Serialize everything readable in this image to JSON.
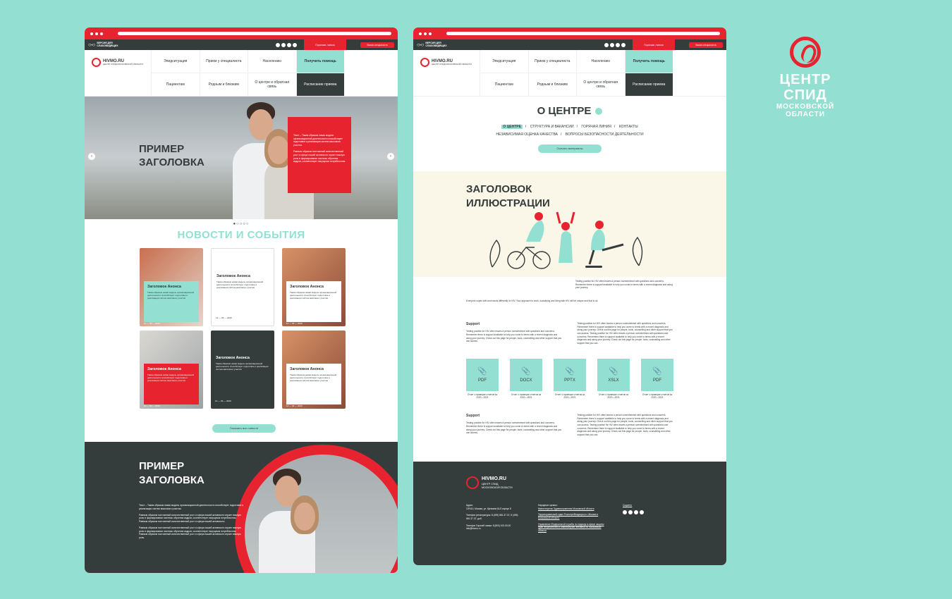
{
  "brand": {
    "title": "ЦЕНТР СПИД",
    "subtitle": "МОСКОВСКОЙ ОБЛАСТИ"
  },
  "topbar": {
    "low_vision": "ВЕРСИЯ ДЛЯ СЛАБОВИДЯЩИХ",
    "hotline": "Горячая линия",
    "urgent": "Вызов специалиста"
  },
  "logo": {
    "name": "HIVMO.RU",
    "tagline": "ЦЕНТР СПИД МОСКОВСКОЙ ОБЛАСТИ"
  },
  "nav": {
    "row1": [
      "Эпидситуация",
      "Прием у специалиста",
      "Населению",
      "Получить помощь"
    ],
    "row2": [
      "Пациентам",
      "Родным и близким",
      "О центре и обратная связь",
      "Расписание приема"
    ]
  },
  "hero": {
    "title_line1": "ПРИМЕР",
    "title_line2": "ЗАГОЛОВКА",
    "card_p1": "Текст – Таким образом новая модель организационной деятельности способствует подготовке и реализации систем массового участия.",
    "card_p2": "Равным образом постоянный количественный рост и сфера нашей активности играет важную роль в формировании системы обучения кадров, соответствует насущным потребностям.",
    "dots": "●○○○○"
  },
  "news": {
    "title": "НОВОСТИ И СОБЫТИЯ",
    "cards": [
      {
        "title": "Заголовок Анонса",
        "text": "Таким образом новая модель организационной деятельности способствует подготовке и реализации систем массового участия",
        "date": "12 — 03 — 2020"
      },
      {
        "title": "Заголовок Анонса",
        "text": "Таким образом новая модель организационной деятельности способствует подготовке и реализации систем массового участия",
        "date": "12 — 03 — 2020"
      },
      {
        "title": "Заголовок Анонса",
        "text": "Таким образом новая модель организационной деятельности способствует подготовке и реализации систем массового участия",
        "date": "12 — 03 — 2020"
      },
      {
        "title": "Заголовок Анонса",
        "text": "Таким образом новая модель организационной деятельности способствует подготовке и реализации систем массового участия",
        "date": "12 — 03 — 2020"
      },
      {
        "title": "Заголовок Анонса",
        "text": "Таким образом новая модель организационной деятельности способствует подготовке и реализации систем массового участия",
        "date": "12 — 03 — 2020"
      },
      {
        "title": "Заголовок Анонса",
        "text": "Таким образом новая модель организационной деятельности способствует подготовке и реализации систем массового участия",
        "date": "12 — 03 — 2020"
      }
    ],
    "show_all": "Показать все новости"
  },
  "promo": {
    "title_line1": "ПРИМЕР",
    "title_line2": "ЗАГОЛОВКА",
    "p1": "Текст – Таким образом новая модель организационной деятельности способствует подготовке и реализации систем массового участия.",
    "p2": "Равным образом постоянный количественный рост и сфера нашей активности играет важную роль в формировании системы обучения кадров, соответствует насущным потребностям. Равным образом постоянный количественный рост и сфера нашей активности.",
    "p3": "Равным образом постоянный количественный рост и сфера нашей активности играет важную роль в формировании системы обучения кадров, соответствует насущным потребностям. Равным образом постоянный количественный рост и сфера нашей активности играет важную роль."
  },
  "about": {
    "title": "О ЦЕНТРЕ",
    "tabs_row1": [
      "О ЦЕНТРЕ",
      "СТРУКТУРА И ВАКАНСИИ",
      "ГОРЯЧАЯ ЛИНИЯ",
      "КОНТАКТЫ"
    ],
    "tabs_row2": [
      "НЕЗАВИСИМАЯ ОЦЕНКА КАЧЕСТВА",
      "ВОПРОСЫ БЕЗОПАСНОСТИ ДЕЯТЕЛЬНОСТИ"
    ],
    "download": "Скачать материалы"
  },
  "illustration": {
    "title_line1": "ЗАГОЛОВОК",
    "title_line2": "ИЛЛЮСТРАЦИИ"
  },
  "article": {
    "side_text": "Testing positive for HIV often leaves a person overwhelmed with questions and concerns. Remember there is support available to help you come to terms with a recent diagnosis and along your journey.",
    "lead": "Everyone copes with and reacts differently to HIV. Your approach to work, socialising and living with HIV will be unique and that is ok.",
    "support_title": "Support",
    "support_left": "Testing positive for HIV often leaves a person overwhelmed with questions and concerns. Remember there is support available to help you come to terms with a recent diagnosis and along your journey. Check out this page for people, tools, counselling and other support that you can access.",
    "support_right": "Testing positive for HIV often leaves a person overwhelmed with questions and concerns. Remember there is support available to help you come to terms with a recent diagnosis and along your journey. Check out this page for people, tools, counselling and other support that you can access. Testing positive for HIV often leaves a person overwhelmed with questions and concerns. Remember there is support available to help you come to terms with a recent diagnosis and along your journey. Check out this page for people, tools, counselling and other support that you can.",
    "support2_title": "Support",
    "support2_left": "Testing positive for HIV often leaves a person overwhelmed with questions and concerns. Remember there is support available to help you come to terms with a recent diagnosis and along your journey. Check out this page for people, tools, counselling and other support that you can access.",
    "support2_right": "Testing positive for HIV often leaves a person overwhelmed with questions and concerns. Remember there is support available to help you come to terms with a recent diagnosis and along your journey. Check out this page for people, tools, counselling and other support that you can access. Testing positive for HIV often leaves a person overwhelmed with questions and concerns. Remember there is support available to help you come to terms with a recent diagnosis and along your journey. Check out this page for people, tools, counselling and other support that you can."
  },
  "files": [
    {
      "ext": "PDF",
      "caption": "Отчет о проверке отчетов за 2020—2021"
    },
    {
      "ext": "DOCX",
      "caption": "Отчет о проверке отчетов за 2020—2021"
    },
    {
      "ext": "PPTX",
      "caption": "Отчет о проверке отчетов за 2020—2021"
    },
    {
      "ext": "XSLX",
      "caption": "Отчет о проверке отчетов за 2020—2021"
    },
    {
      "ext": "PDF",
      "caption": "Отчет о проверке отчетов за 2020—2021"
    }
  ],
  "footer": {
    "name": "HIVMO.RU",
    "tagline1": "ЦЕНТР СПИД",
    "tagline2": "МОСКОВСКОЙ ОБЛАСТИ",
    "address_label": "Адрес:",
    "address": "129110, Москва, ул. Щепкина 61/2 корпус 8",
    "phones": "Телефон регистратуры: 8 (499) 681-37-37, 8 (495) 681-37-37, доб.",
    "hotline": "Телефон Горячей линии: 8 (800) 100-00-00",
    "email": "info@hivmo.ru",
    "links_label": "Народные органы:",
    "link1": "Министерство Здравоохранения Московской области",
    "link2": "Территориальный отдел Роспотребнадзора по г.Москве и Московской области",
    "link3": "Управление Федеральной службы по надзору в сфере защиты прав потребителей и благополучия человека по Московской области",
    "socials_label": "Соцсети:"
  }
}
